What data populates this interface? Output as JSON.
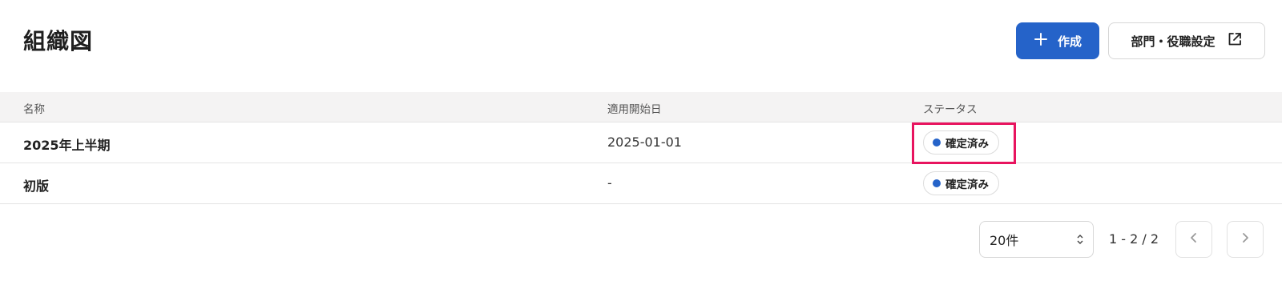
{
  "header": {
    "title": "組織図",
    "create_label": "作成",
    "dept_settings_label": "部門・役職設定"
  },
  "table": {
    "columns": [
      "名称",
      "適用開始日",
      "ステータス"
    ],
    "rows": [
      {
        "name": "2025年上半期",
        "start_date": "2025-01-01",
        "status": "確定済み"
      },
      {
        "name": "初版",
        "start_date": "-",
        "status": "確定済み"
      }
    ]
  },
  "pagination": {
    "page_size": "20件",
    "range": "1 - 2 / 2"
  },
  "icons": {
    "plus": "plus-icon",
    "external": "external-link-icon",
    "prev": "chevron-left-icon",
    "next": "chevron-right-icon",
    "select_arrows": "select-arrows-icon"
  },
  "colors": {
    "accent": "#2563c9",
    "status_dot": "#2563c9",
    "highlight": "#e8145f"
  }
}
